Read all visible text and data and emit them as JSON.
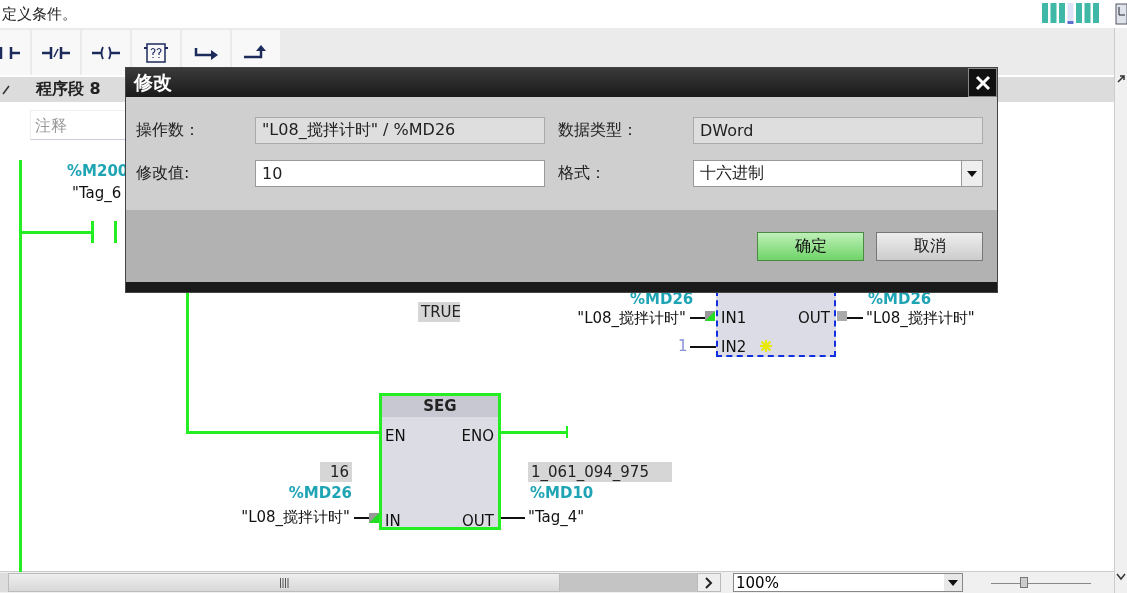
{
  "hint_text": "定义条件。",
  "toolbar": {
    "buttons": [
      {
        "kind": "no_contact"
      },
      {
        "kind": "nc_contact"
      },
      {
        "kind": "coil"
      },
      {
        "kind": "empty_box"
      },
      {
        "kind": "open_branch"
      },
      {
        "kind": "close_branch"
      }
    ]
  },
  "network": {
    "title": "程序段 8",
    "comment_placeholder": "注释"
  },
  "diagram": {
    "contact": {
      "address": "%M200",
      "tag": "\"Tag_6"
    },
    "move_box": {
      "status_value": "TRUE",
      "in1_address": "%MD26",
      "in1_tag": "\"L08_搅拌计时\"",
      "in1_pin": "IN1",
      "in2_value": "1",
      "in2_pin": "IN2",
      "out_pin": "OUT",
      "out_address": "%MD26",
      "out_tag": "\"L08_搅拌计时\""
    },
    "seg_box": {
      "title": "SEG",
      "en_pin": "EN",
      "eno_pin": "ENO",
      "in_pin": "IN",
      "out_pin": "OUT",
      "in_value": "16",
      "in_address": "%MD26",
      "in_tag": "\"L08_搅拌计时\"",
      "out_value": "1_061_094_975",
      "out_address": "%MD10",
      "out_tag": "\"Tag_4\""
    }
  },
  "dialog": {
    "title": "修改",
    "fields": [
      {
        "label": "操作数：",
        "value": "\"L08_搅拌计时\" / %MD26",
        "kind": "readonly"
      },
      {
        "label": "数据类型：",
        "value": "DWord",
        "kind": "readonly"
      },
      {
        "label": "修改值:",
        "value": "10",
        "kind": "input"
      },
      {
        "label": "格式：",
        "value": "十六进制",
        "kind": "select"
      }
    ],
    "buttons": [
      {
        "label": "确定",
        "primary": true
      },
      {
        "label": "取消",
        "primary": false
      }
    ]
  },
  "status_bar": {
    "zoom": "100%",
    "zoom_slider": {
      "level": 0.33
    }
  }
}
